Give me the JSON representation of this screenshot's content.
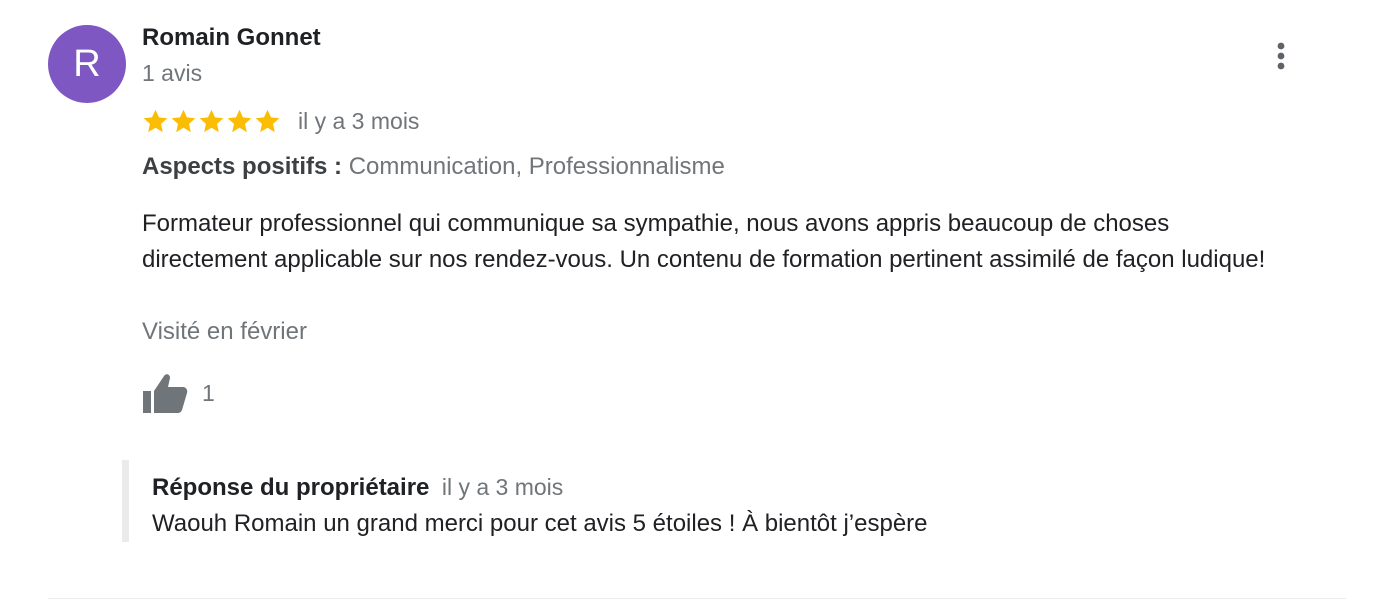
{
  "review": {
    "author": {
      "avatar_letter": "R",
      "avatar_color": "#7e57c2",
      "name": "Romain Gonnet",
      "meta": "1 avis"
    },
    "more_icon": "more-vert-icon",
    "rating": {
      "stars": 5,
      "max_stars": 5,
      "star_color": "#fbbc04",
      "date": "il y a 3 mois"
    },
    "aspects": {
      "label": "Aspects positifs :",
      "values": "Communication, Professionnalisme"
    },
    "text": "Formateur professionnel qui communique sa sympathie, nous avons appris beaucoup de choses directement applicable sur nos rendez-vous. Un contenu de formation pertinent assimilé de façon ludique!",
    "visit": "Visité en février",
    "like": {
      "icon": "thumbs-up-icon",
      "count": "1"
    },
    "owner_response": {
      "title": "Réponse du propriétaire",
      "date": "il y a 3 mois",
      "text": "Waouh Romain un grand merci pour cet avis 5 étoiles ! À bientôt j’espère"
    }
  }
}
